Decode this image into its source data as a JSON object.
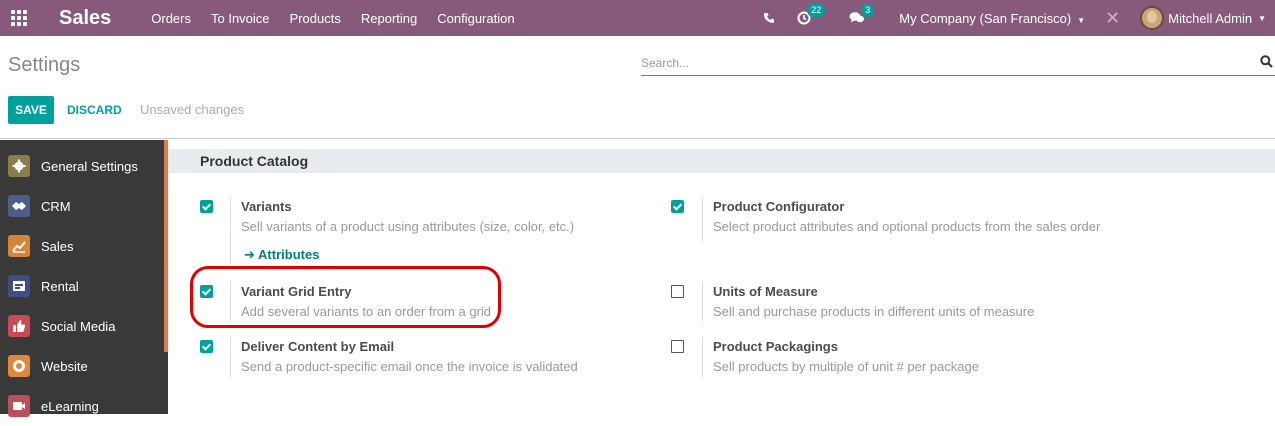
{
  "navbar": {
    "brand": "Sales",
    "menu": [
      "Orders",
      "To Invoice",
      "Products",
      "Reporting",
      "Configuration"
    ],
    "activities_count": "22",
    "messages_count": "3",
    "company": "My Company (San Francisco)",
    "user": "Mitchell Admin",
    "accent": "#875a7b"
  },
  "control_panel": {
    "title": "Settings",
    "search_placeholder": "Search...",
    "save_label": "SAVE",
    "discard_label": "DISCARD",
    "status": "Unsaved changes"
  },
  "sidebar": {
    "items": [
      {
        "label": "General Settings",
        "icon": "gear-icon",
        "color": "#8a6d3b"
      },
      {
        "label": "CRM",
        "icon": "handshake-icon",
        "color": "#4a6ca8"
      },
      {
        "label": "Sales",
        "icon": "chart-icon",
        "color": "#e07b3a"
      },
      {
        "label": "Rental",
        "icon": "rental-icon",
        "color": "#3d4f88"
      },
      {
        "label": "Social Media",
        "icon": "thumbs-up-icon",
        "color": "#d9534f"
      },
      {
        "label": "Website",
        "icon": "globe-icon",
        "color": "#e8843a"
      },
      {
        "label": "eLearning",
        "icon": "elearning-icon",
        "color": "#c0504d"
      }
    ],
    "active": "Sales"
  },
  "section": {
    "title": "Product Catalog",
    "settings": [
      {
        "title": "Variants",
        "desc": "Sell variants of a product using attributes (size, color, etc.)",
        "checked": true,
        "link": "Attributes"
      },
      {
        "title": "Product Configurator",
        "desc": "Select product attributes and optional products from the sales order",
        "checked": true
      },
      {
        "title": "Variant Grid Entry",
        "desc": "Add several variants to an order from a grid",
        "checked": true
      },
      {
        "title": "Units of Measure",
        "desc": "Sell and purchase products in different units of measure",
        "checked": false
      },
      {
        "title": "Deliver Content by Email",
        "desc": "Send a product-specific email once the invoice is validated",
        "checked": true
      },
      {
        "title": "Product Packagings",
        "desc": "Sell products by multiple of unit # per package",
        "checked": false
      }
    ]
  }
}
